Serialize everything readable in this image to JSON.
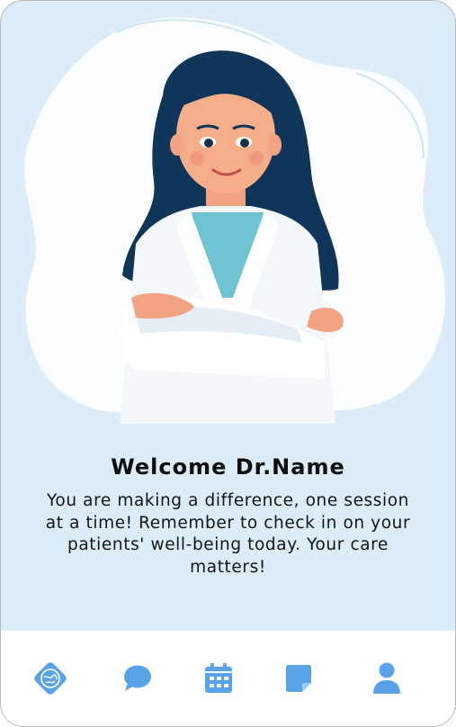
{
  "welcome": {
    "title": "Welcome Dr.Name",
    "message": "You are making a difference, one session at a time! Remember to check in on your patients' well-being today. Your care matters!"
  },
  "nav": {
    "items": [
      {
        "icon": "brain-logo-icon",
        "active": true
      },
      {
        "icon": "chat-bubble-icon"
      },
      {
        "icon": "calendar-icon"
      },
      {
        "icon": "sticky-note-icon"
      },
      {
        "icon": "user-profile-icon"
      }
    ]
  },
  "colors": {
    "background": "#dcecf9",
    "accent": "#5aa3e8",
    "nav_background": "#ffffff",
    "text": "#111111"
  }
}
